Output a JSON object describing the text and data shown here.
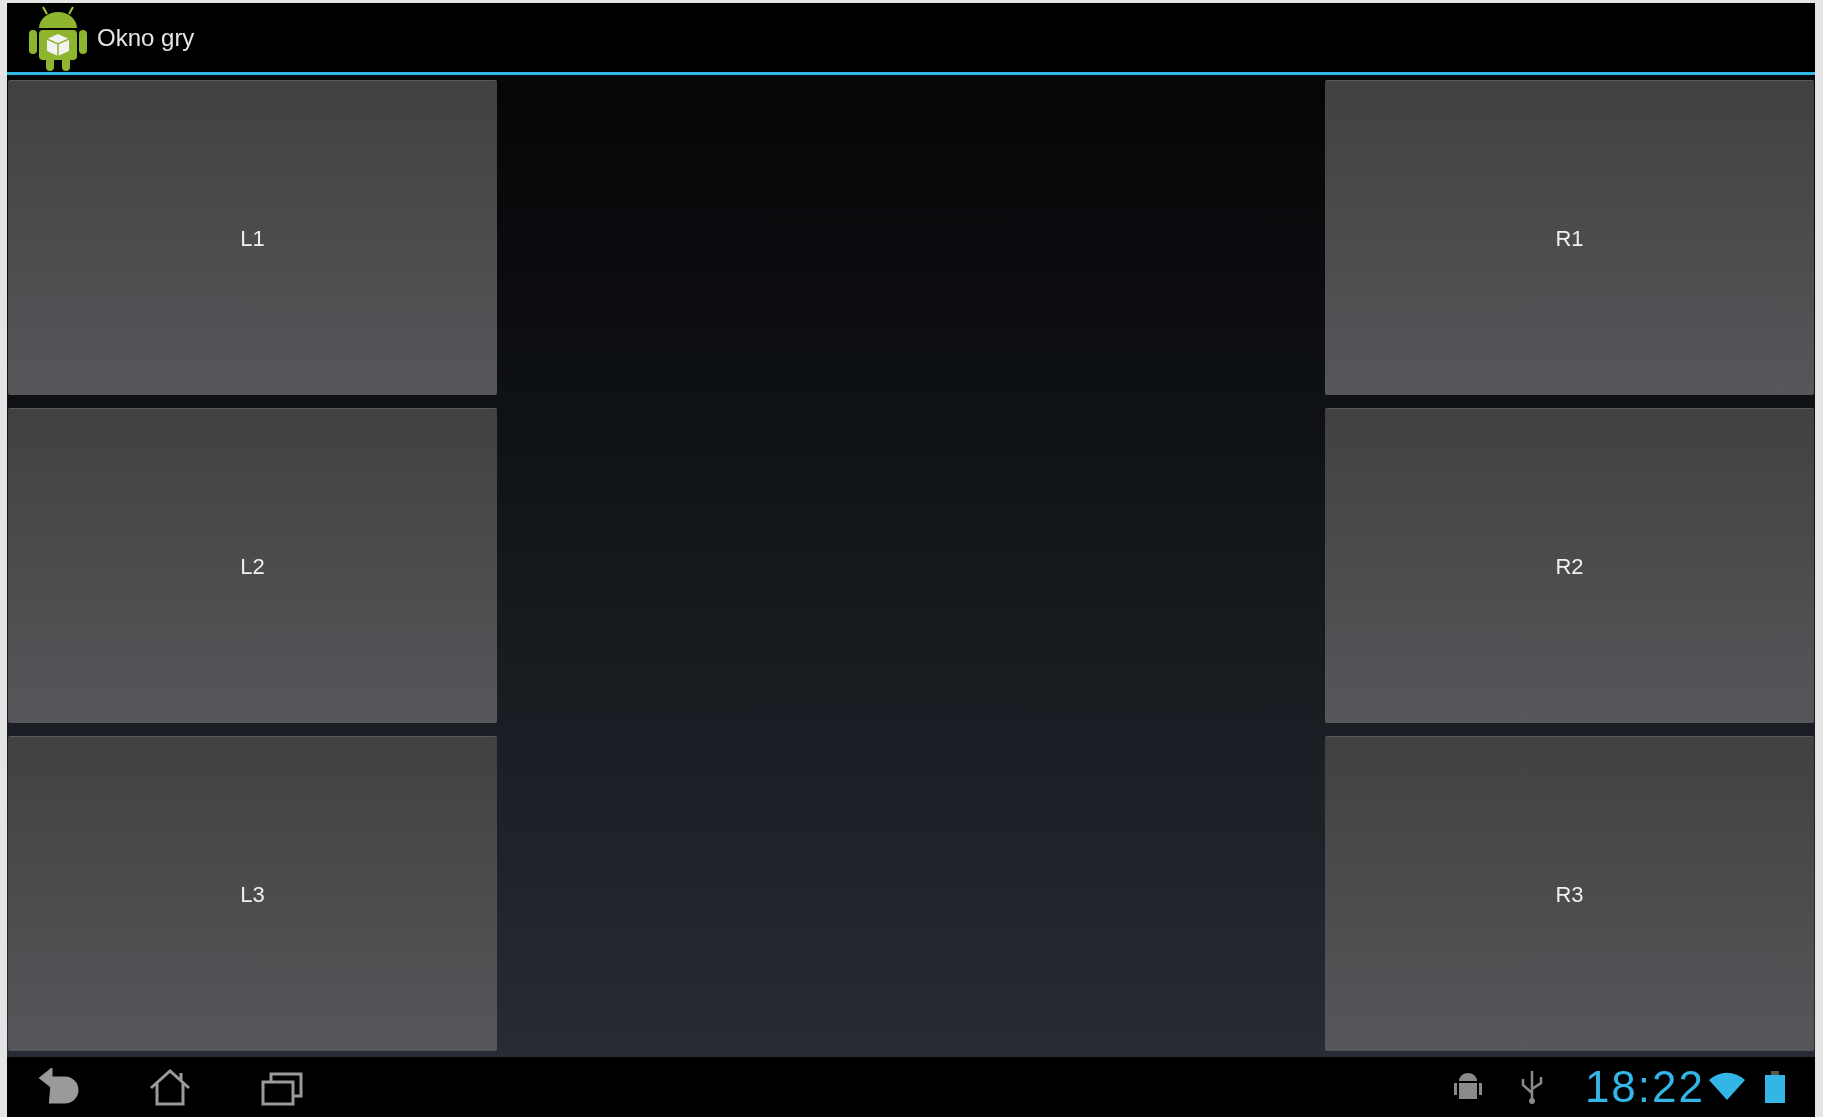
{
  "action_bar": {
    "title": "Okno gry"
  },
  "left_buttons": [
    {
      "label": "L1"
    },
    {
      "label": "L2"
    },
    {
      "label": "L3"
    }
  ],
  "right_buttons": [
    {
      "label": "R1"
    },
    {
      "label": "R2"
    },
    {
      "label": "R3"
    }
  ],
  "system_bar": {
    "time": "18:22"
  }
}
